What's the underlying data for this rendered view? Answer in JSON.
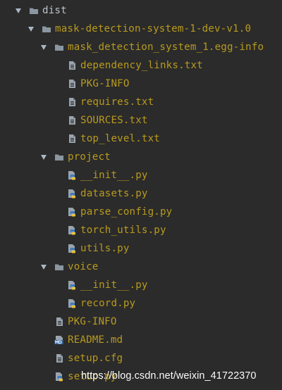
{
  "project_tree": {
    "items": [
      {
        "name": "dist",
        "type": "folder",
        "expanded": true
      },
      {
        "name": "mask-detection-system-1-dev-v1.0",
        "type": "folder",
        "expanded": true
      },
      {
        "name": "mask_detection_system_1.egg-info",
        "type": "folder",
        "expanded": true
      },
      {
        "name": "dependency_links.txt",
        "type": "text-file"
      },
      {
        "name": "PKG-INFO",
        "type": "text-file"
      },
      {
        "name": "requires.txt",
        "type": "text-file"
      },
      {
        "name": "SOURCES.txt",
        "type": "text-file"
      },
      {
        "name": "top_level.txt",
        "type": "text-file"
      },
      {
        "name": "project",
        "type": "folder",
        "expanded": true
      },
      {
        "name": "__init__.py",
        "type": "python-file"
      },
      {
        "name": "datasets.py",
        "type": "python-file"
      },
      {
        "name": "parse_config.py",
        "type": "python-file"
      },
      {
        "name": "torch_utils.py",
        "type": "python-file"
      },
      {
        "name": "utils.py",
        "type": "python-file"
      },
      {
        "name": "voice",
        "type": "folder",
        "expanded": true
      },
      {
        "name": "__init__.py",
        "type": "python-file"
      },
      {
        "name": "record.py",
        "type": "python-file"
      },
      {
        "name": "PKG-INFO",
        "type": "text-file"
      },
      {
        "name": "README.md",
        "type": "markdown-file"
      },
      {
        "name": "setup.cfg",
        "type": "text-file"
      },
      {
        "name": "setup.py",
        "type": "python-file"
      }
    ]
  },
  "watermark": {
    "text": "https://blog.csdn.net/weixin_41722370"
  },
  "colors": {
    "background": "#2b2b2b",
    "root_label": "#b9c3cc",
    "file_label": "#b89a1e",
    "folder_icon": "#8a96a0",
    "arrow": "#a9b7c6"
  },
  "icons": {
    "folder": "folder-icon",
    "text-file": "text-file-icon",
    "python-file": "python-file-icon",
    "markdown-file": "markdown-file-icon",
    "expanded": "chevron-down-icon"
  }
}
